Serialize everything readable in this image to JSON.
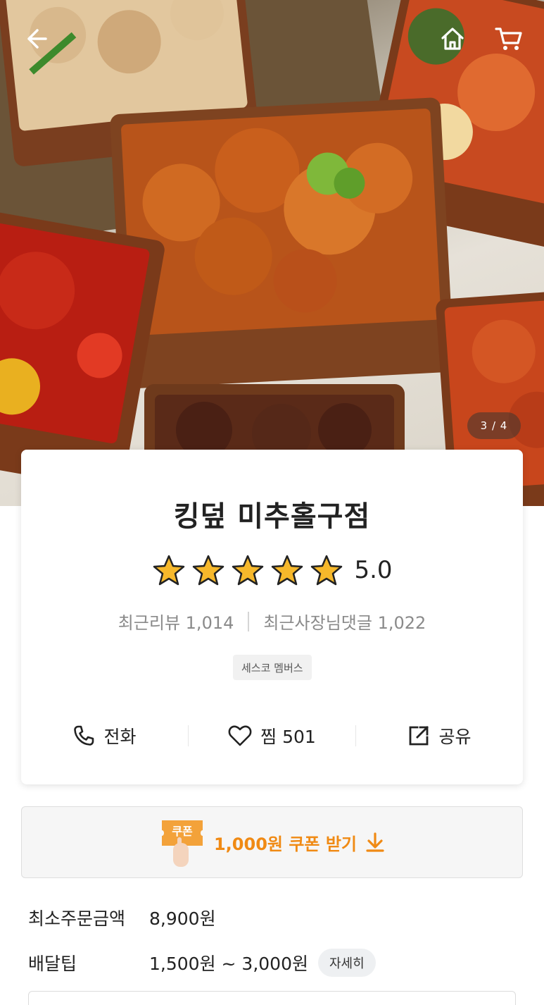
{
  "hero": {
    "image_counter": "3 / 4",
    "icons": [
      "back-arrow-icon",
      "home-icon",
      "cart-icon"
    ]
  },
  "store": {
    "name": "킹덮 미추홀구점",
    "rating": "5.0",
    "stars_filled": 5,
    "stars_total": 5,
    "recent_reviews": "최근리뷰 1,014",
    "recent_owner_replies": "최근사장님댓글 1,022",
    "badge": "세스코 멤버스"
  },
  "actions": {
    "call_label": "전화",
    "favorite_label": "찜",
    "favorite_count": "501",
    "share_label": "공유"
  },
  "coupon": {
    "tag_label": "쿠폰",
    "text": "1,000원 쿠폰 받기"
  },
  "info": {
    "min_order_label": "최소주문금액",
    "min_order_value": "8,900원",
    "delivery_tip_label": "배달팁",
    "delivery_tip_value": "1,500원 ~ 3,000원",
    "detail_button": "자세히"
  },
  "colors": {
    "accent": "#f08a14",
    "star": "#f6b82b",
    "text": "#222222",
    "muted": "#8a8a8a"
  }
}
